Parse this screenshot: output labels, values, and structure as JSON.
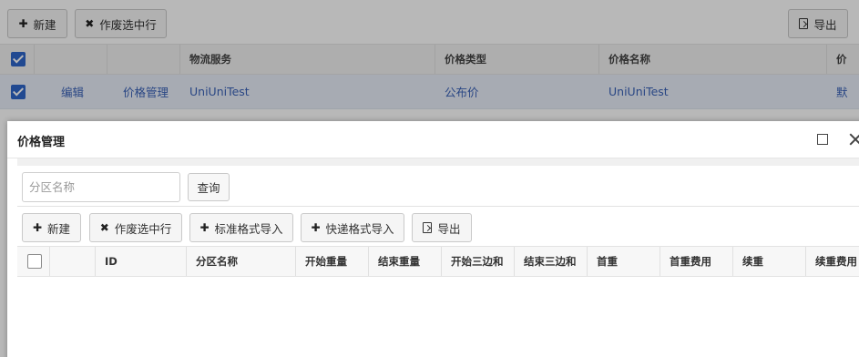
{
  "bg_toolbar": {
    "new_label": "新建",
    "void_label": "作废选中行",
    "export_label": "导出"
  },
  "bg_table": {
    "columns": [
      "",
      "",
      "",
      "物流服务",
      "价格类型",
      "价格名称",
      "价"
    ],
    "row": {
      "edit": "编辑",
      "price_manage": "价格管理",
      "logistics": "UniUniTest",
      "price_type": "公布价",
      "price_name": "UniUniTest",
      "default": "默"
    }
  },
  "modal": {
    "title": "价格管理",
    "search_placeholder": "分区名称",
    "query_label": "查询",
    "toolbar": {
      "new_label": "新建",
      "void_label": "作废选中行",
      "std_import_label": "标准格式导入",
      "fast_import_label": "快递格式导入",
      "export_label": "导出"
    },
    "columns": [
      "ID",
      "分区名称",
      "开始重量",
      "结束重量",
      "开始三边和",
      "结束三边和",
      "首重",
      "首重费用",
      "续重",
      "续重费用"
    ]
  },
  "colors": {
    "accent": "#2f66c9",
    "link": "#3a62b8",
    "selected_row": "#e8eef8"
  }
}
